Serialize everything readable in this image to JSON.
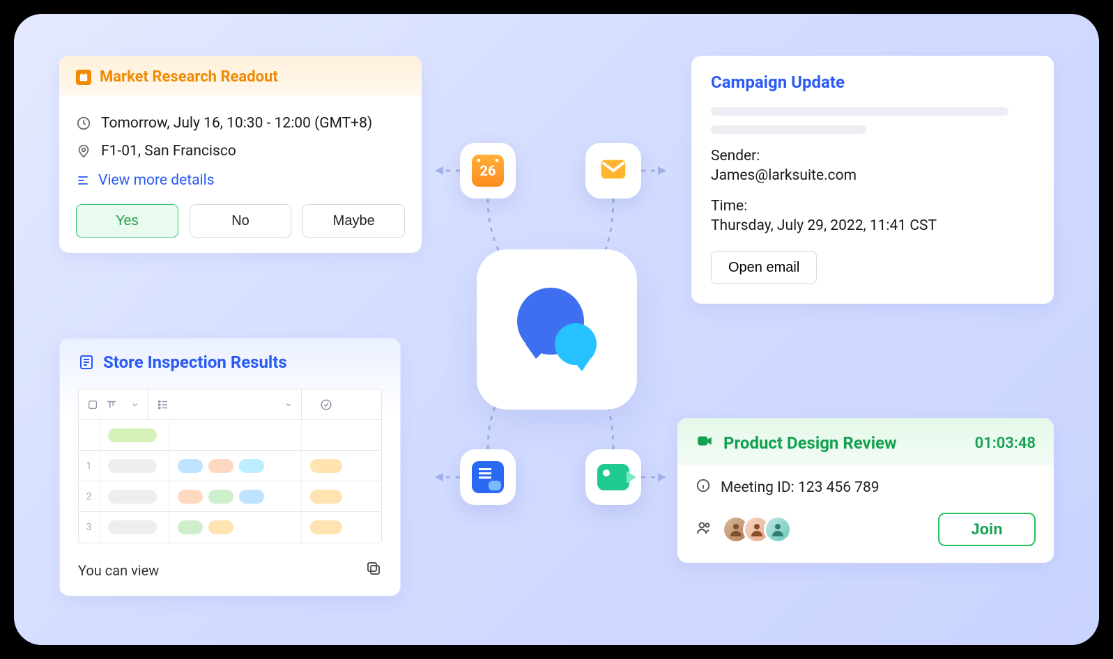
{
  "calendar_card": {
    "title": "Market Research Readout",
    "time_text": "Tomorrow, July 16, 10:30 - 12:00 (GMT+8)",
    "location_text": "F1-01, San Francisco",
    "view_more": "View more details",
    "btn_yes": "Yes",
    "btn_no": "No",
    "btn_maybe": "Maybe"
  },
  "email_card": {
    "title": "Campaign Update",
    "sender_label": "Sender:",
    "sender_value": "James@larksuite.com",
    "time_label": "Time:",
    "time_value": "Thursday, July 29, 2022, 11:41 CST",
    "open_btn": "Open email"
  },
  "base_card": {
    "title": "Store Inspection Results",
    "row_labels": [
      "1",
      "2",
      "3"
    ],
    "footer_text": "You can view"
  },
  "meeting_card": {
    "title": "Product Design Review",
    "timer": "01:03:48",
    "meeting_id_label": "Meeting ID: 123 456 789",
    "join_btn": "Join"
  },
  "hub": {
    "calendar_day": "26"
  }
}
